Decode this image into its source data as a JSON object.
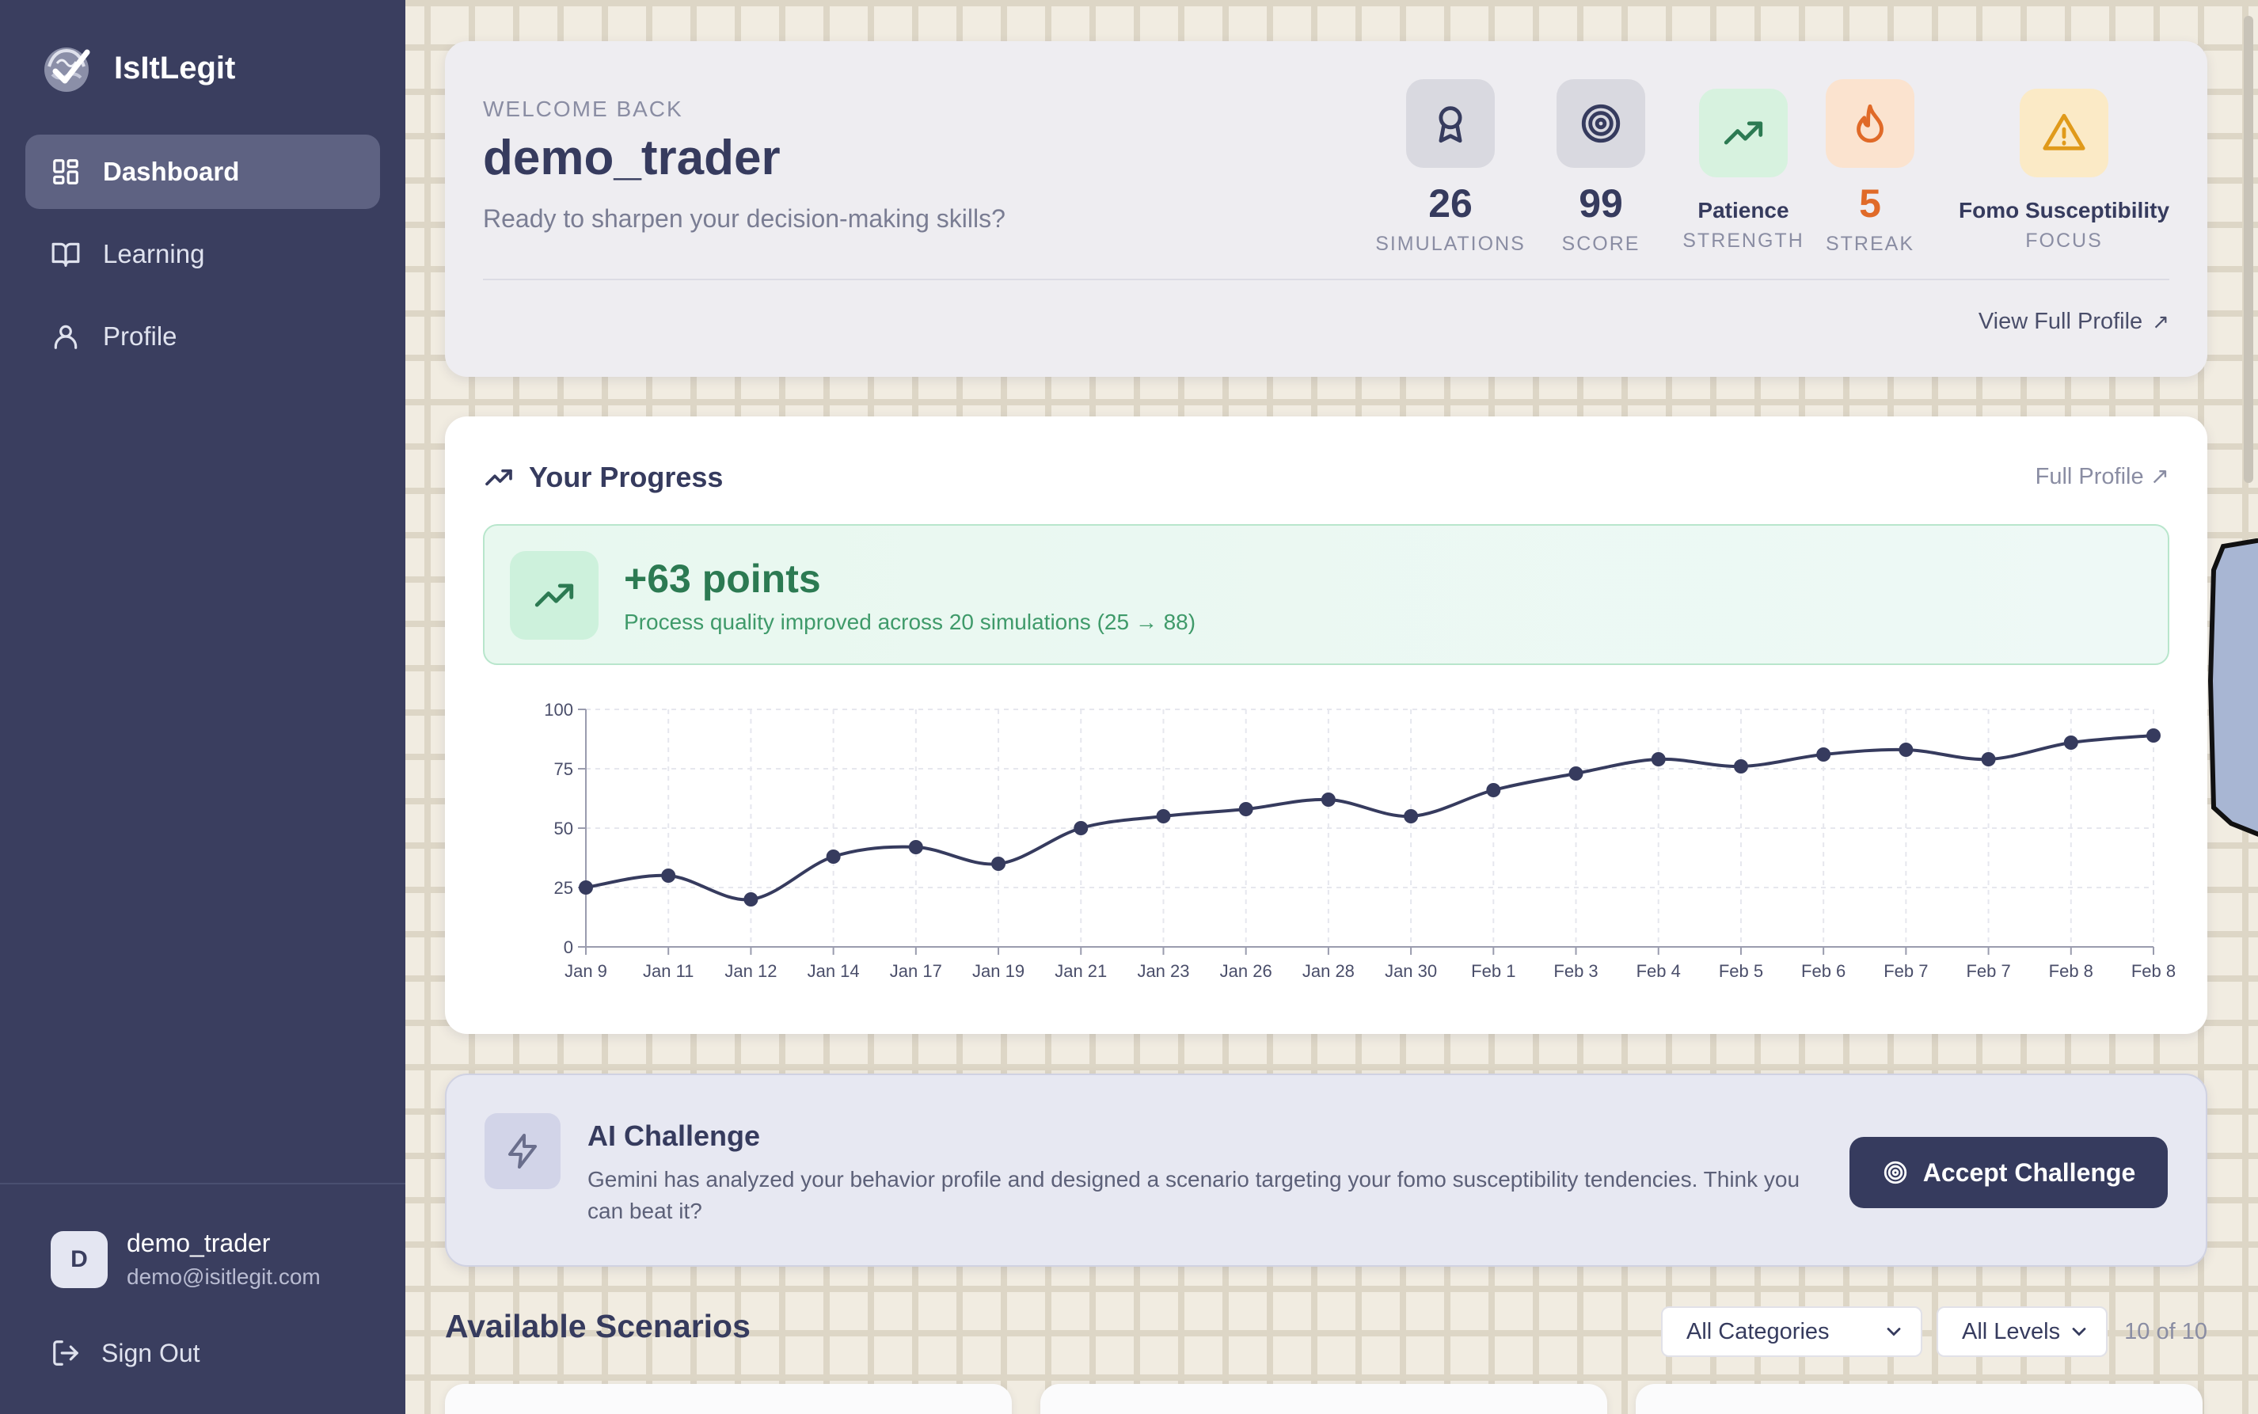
{
  "brand": {
    "name": "IsItLegit"
  },
  "nav": {
    "items": [
      {
        "label": "Dashboard",
        "icon": "dashboard-icon",
        "active": true
      },
      {
        "label": "Learning",
        "icon": "book-icon",
        "active": false
      },
      {
        "label": "Profile",
        "icon": "user-icon",
        "active": false
      }
    ]
  },
  "user": {
    "initial": "D",
    "name": "demo_trader",
    "email": "demo@isitlegit.com"
  },
  "signout": {
    "label": "Sign Out"
  },
  "welcome": {
    "kicker": "WELCOME BACK",
    "name": "demo_trader",
    "subtitle": "Ready to sharpen your decision-making skills?",
    "view_full_profile": "View Full Profile",
    "stats": [
      {
        "value": "26",
        "label": "SIMULATIONS",
        "icon": "award-icon",
        "bg": "#d9d9e0",
        "color": "#363b5e"
      },
      {
        "value": "99",
        "label": "SCORE",
        "icon": "target-icon",
        "bg": "#d9d9e0",
        "color": "#363b5e"
      },
      {
        "value": "Patience",
        "label": "STRENGTH",
        "icon": "trending-up-icon",
        "bg": "#d7f2df",
        "color": "#2c7a52"
      },
      {
        "value": "5",
        "label": "STREAK",
        "icon": "flame-icon",
        "bg": "#fbe3cf",
        "color": "#e06a28"
      },
      {
        "value": "Fomo Susceptibility",
        "label": "FOCUS",
        "icon": "warning-icon",
        "bg": "#fbeac6",
        "color": "#e09a1a"
      }
    ]
  },
  "progress": {
    "title": "Your Progress",
    "full_profile": "Full Profile",
    "gain_title": "+63 points",
    "gain_desc": "Process quality improved across 20 simulations (25 → 88)"
  },
  "chart_data": {
    "type": "line",
    "categories": [
      "Jan 9",
      "Jan 11",
      "Jan 12",
      "Jan 14",
      "Jan 17",
      "Jan 19",
      "Jan 21",
      "Jan 23",
      "Jan 26",
      "Jan 28",
      "Jan 30",
      "Feb 1",
      "Feb 3",
      "Feb 4",
      "Feb 5",
      "Feb 6",
      "Feb 7",
      "Feb 7",
      "Feb 8",
      "Feb 8"
    ],
    "series": [
      {
        "values": [
          25,
          30,
          20,
          38,
          42,
          35,
          50,
          55,
          58,
          62,
          55,
          66,
          73,
          79,
          76,
          81,
          83,
          79,
          86,
          89
        ]
      }
    ],
    "yticks": [
      0,
      25,
      50,
      75,
      100
    ],
    "ylim": [
      0,
      100
    ],
    "grid": true,
    "line_color": "#363b5e"
  },
  "challenge": {
    "title": "AI Challenge",
    "desc": "Gemini has analyzed your behavior profile and designed a scenario targeting your fomo susceptibility tendencies. Think you can beat it?",
    "button": "Accept Challenge"
  },
  "scenarios": {
    "title": "Available Scenarios",
    "category_select": "All Categories",
    "level_select": "All Levels",
    "count": "10 of 10"
  }
}
